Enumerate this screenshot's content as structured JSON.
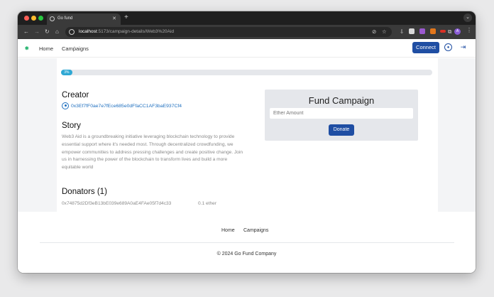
{
  "browser": {
    "tab_title": "Go fund",
    "new_tab_label": "+",
    "url_host": "localhost",
    "url_path": ":5173/campaign-details/Web3%20Aid",
    "profile_initial": "A"
  },
  "nav": {
    "home_label": "Home",
    "campaigns_label": "Campaigns",
    "connect_label": "Connect"
  },
  "campaign": {
    "progress_label": "3%",
    "progress_fraction": 0.03,
    "creator_heading": "Creator",
    "creator_address": "0x3Ef7fF0ae7e7fEce685e0dFfaCC1AF3baE937Cf4",
    "story_heading": "Story",
    "story_text": "Web3 Aid is a groundbreaking initiative leveraging blockchain technology to provide essential support where it's needed most. Through decentralized crowdfunding, we empower communities to address pressing challenges and create positive change. Join us in harnessing the power of the blockchain to transform lives and build a more equitable world",
    "donators_heading": "Donators (1)",
    "donators": [
      {
        "address": "0x74875d2Df3eB13bE039e689A0aE4FAe05f7d4c33",
        "amount": "0.1 ether"
      }
    ]
  },
  "fund": {
    "title": "Fund Campaign",
    "input_placeholder": "Ether Amount",
    "donate_label": "Donate"
  },
  "footer": {
    "home_label": "Home",
    "campaigns_label": "Campaigns",
    "copyright": "© 2024 Go Fund Company"
  },
  "colors": {
    "primary": "#1f4ea3",
    "progress": "#2fa8d4",
    "link": "#1e6fbf"
  }
}
